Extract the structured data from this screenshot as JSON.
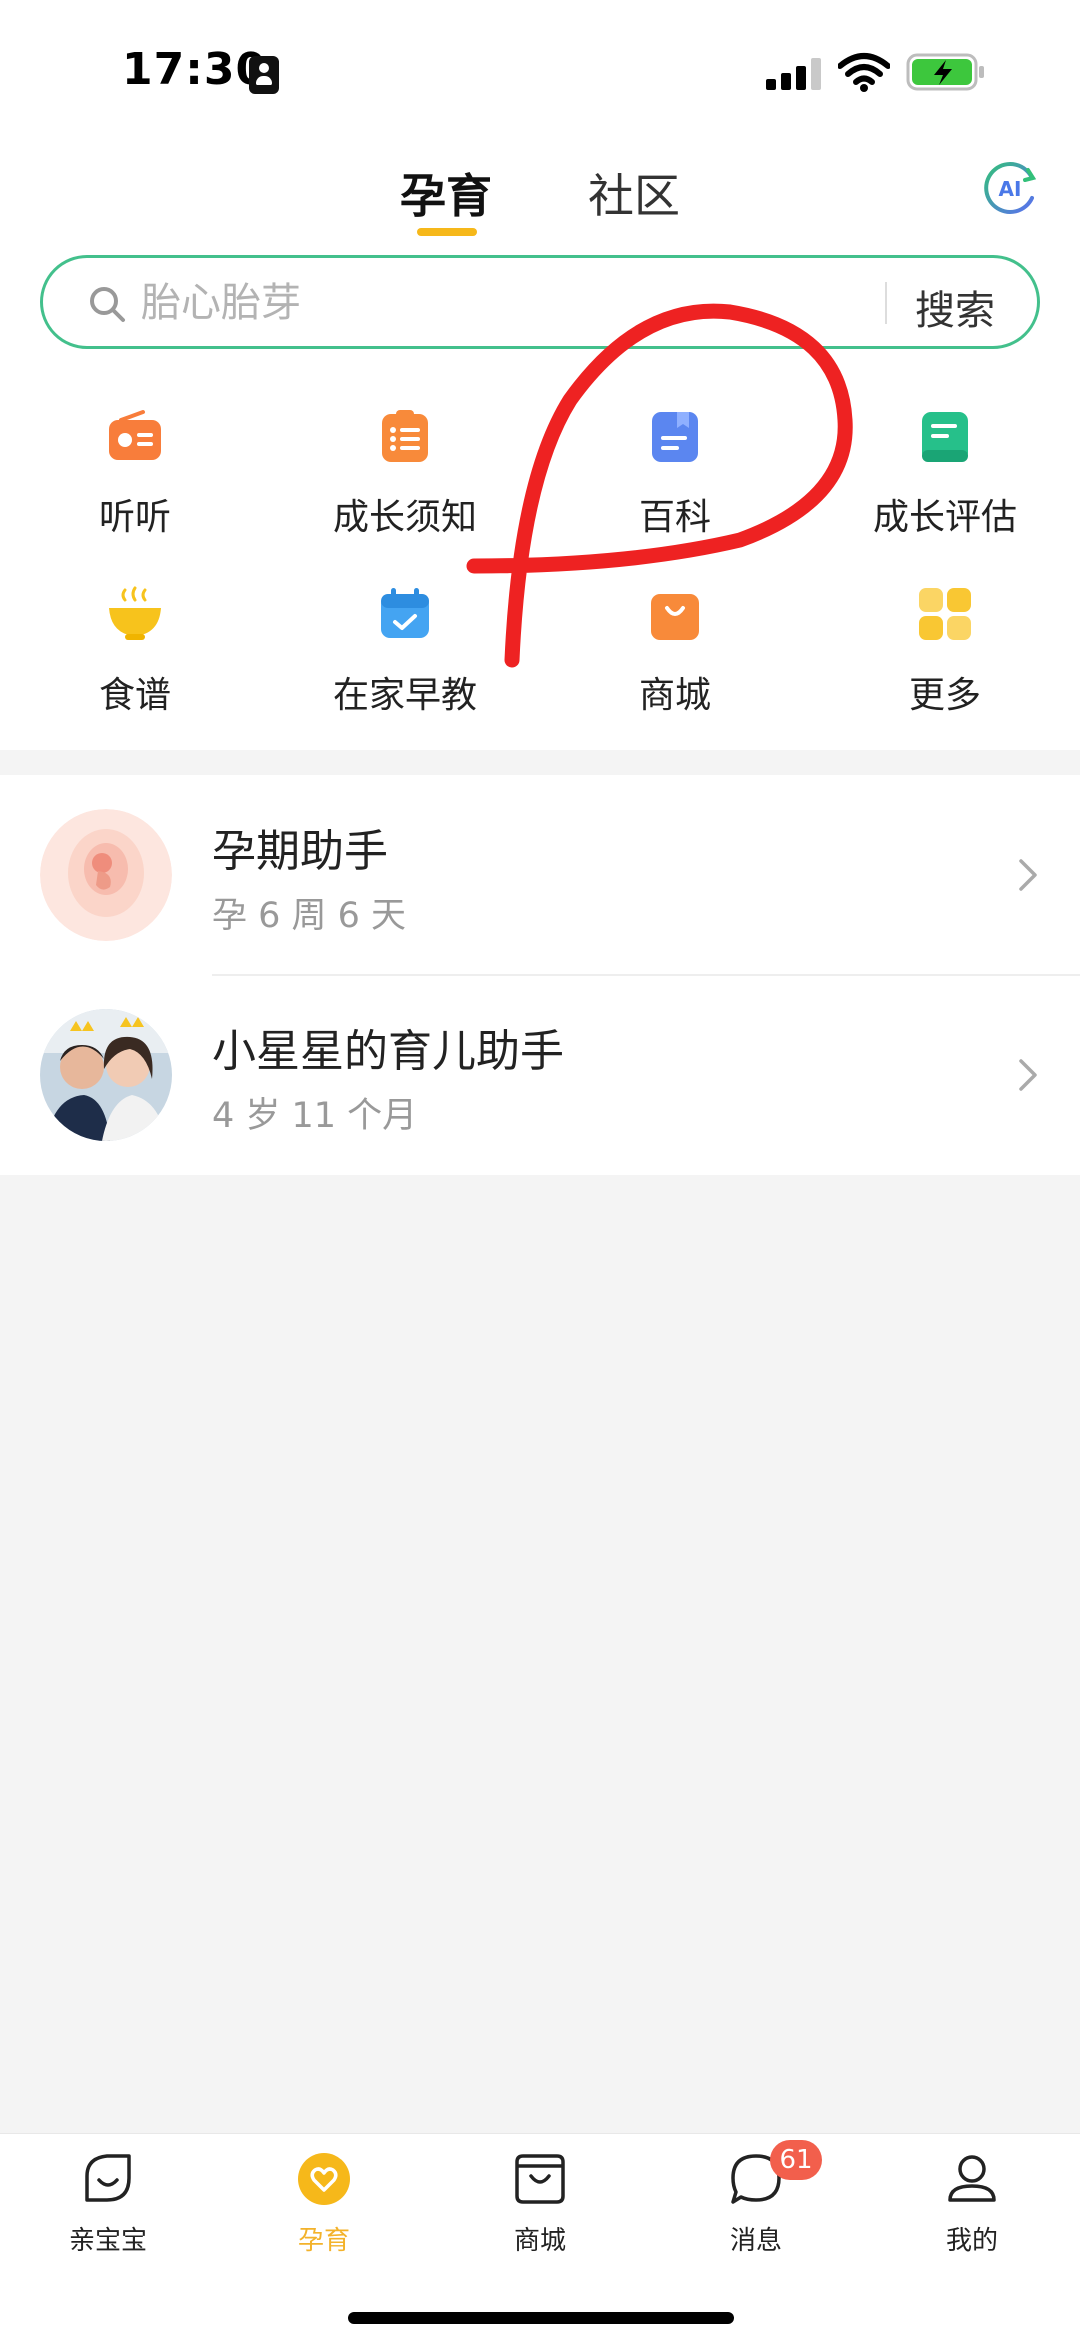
{
  "status_bar": {
    "time": "17:30"
  },
  "header": {
    "tabs": [
      {
        "label": "孕育",
        "active": true
      },
      {
        "label": "社区",
        "active": false
      }
    ],
    "ai_label": "AI",
    "accent_color": "#f6b81a"
  },
  "search": {
    "placeholder": "胎心胎芽",
    "button_label": "搜索",
    "border_color": "#43c08c"
  },
  "grid": {
    "items": [
      {
        "label": "听听",
        "icon": "radio-icon",
        "color": "#f87d3b"
      },
      {
        "label": "成长须知",
        "icon": "checklist-icon",
        "color": "#f88a3a"
      },
      {
        "label": "百科",
        "icon": "encyclopedia-icon",
        "color": "#5b86f0"
      },
      {
        "label": "成长评估",
        "icon": "assessment-icon",
        "color": "#26c08a"
      },
      {
        "label": "食谱",
        "icon": "bowl-icon",
        "color": "#f7c31c"
      },
      {
        "label": "在家早教",
        "icon": "calendar-icon",
        "color": "#44a4f2"
      },
      {
        "label": "商城",
        "icon": "shopping-bag-icon",
        "color": "#f88a3a"
      },
      {
        "label": "更多",
        "icon": "more-grid-icon",
        "color": "#f9c733"
      }
    ]
  },
  "assistants": [
    {
      "title": "孕期助手",
      "subtitle": "孕 6 周 6 天",
      "avatar": "fetus-avatar"
    },
    {
      "title": "小星星的育儿助手",
      "subtitle": "4 岁 11 个月",
      "avatar": "family-photo-avatar"
    }
  ],
  "annotation": {
    "type": "red-freehand-loop",
    "color": "#ee2222"
  },
  "bottom_nav": {
    "items": [
      {
        "label": "亲宝宝",
        "icon": "leaf-icon",
        "active": false
      },
      {
        "label": "孕育",
        "icon": "heart-icon",
        "active": true
      },
      {
        "label": "商城",
        "icon": "bag-icon",
        "active": false
      },
      {
        "label": "消息",
        "icon": "chat-icon",
        "active": false,
        "badge": "61"
      },
      {
        "label": "我的",
        "icon": "person-icon",
        "active": false
      }
    ],
    "active_color": "#f3b22a",
    "badge_color": "#f25f4c"
  }
}
